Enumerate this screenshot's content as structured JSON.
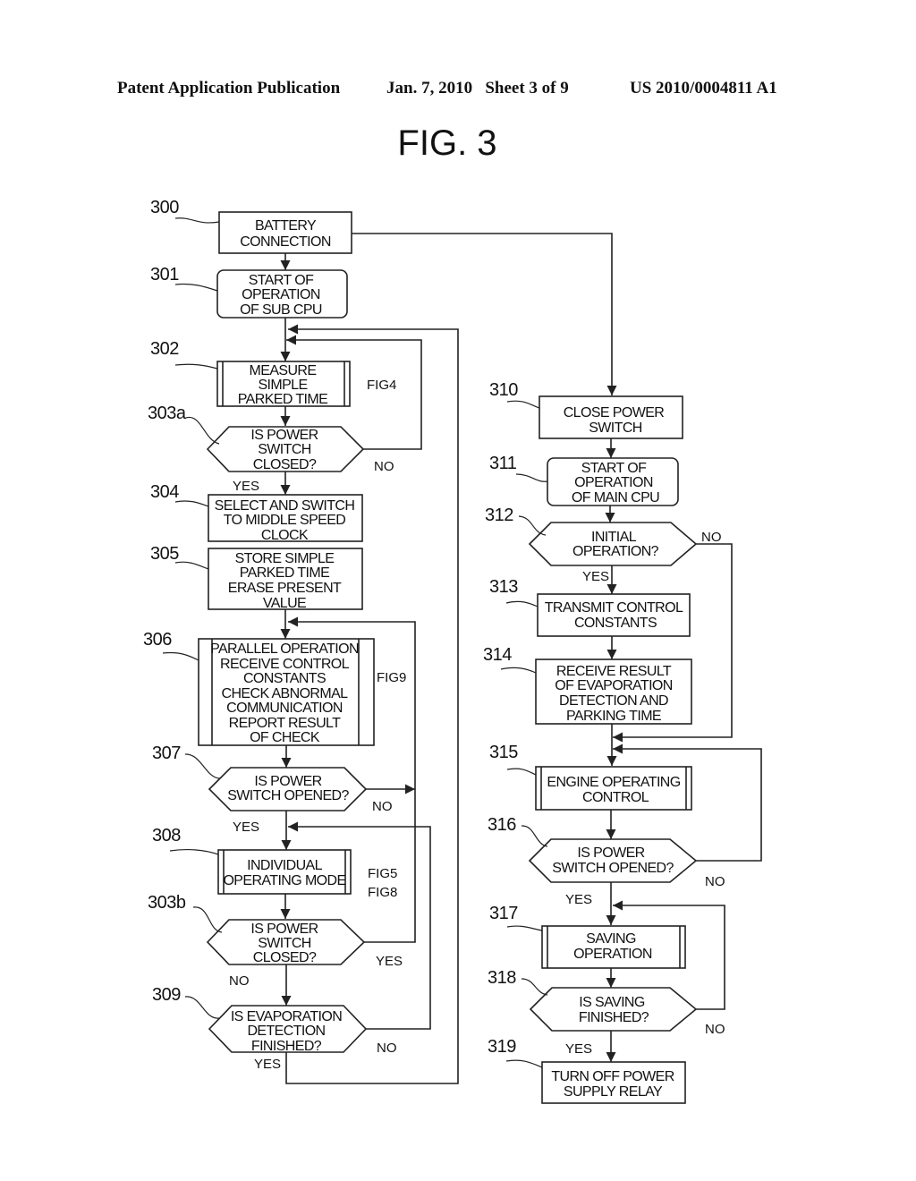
{
  "header": {
    "left": "Patent Application Publication",
    "middle": "Jan. 7, 2010   Sheet 3 of 9",
    "right": "US 2010/0004811 A1"
  },
  "figure_title": "FIG. 3",
  "steps": {
    "s300": {
      "ref": "300",
      "lines": [
        "BATTERY",
        "CONNECTION"
      ]
    },
    "s301": {
      "ref": "301",
      "lines": [
        "START OF",
        "OPERATION",
        "OF SUB CPU"
      ]
    },
    "s302": {
      "ref": "302",
      "lines": [
        "MEASURE",
        "SIMPLE",
        "PARKED TIME"
      ],
      "fig_ref": "FIG4"
    },
    "s303a": {
      "ref": "303a",
      "lines": [
        "IS POWER",
        "SWITCH",
        "CLOSED?"
      ]
    },
    "s304": {
      "ref": "304",
      "lines": [
        "SELECT AND SWITCH",
        "TO MIDDLE SPEED",
        "CLOCK"
      ]
    },
    "s305": {
      "ref": "305",
      "lines": [
        "STORE SIMPLE",
        "PARKED TIME",
        "ERASE PRESENT",
        "VALUE"
      ]
    },
    "s306": {
      "ref": "306",
      "lines": [
        "PARALLEL OPERATION",
        "RECEIVE CONTROL",
        "CONSTANTS",
        "CHECK ABNORMAL",
        "COMMUNICATION",
        "REPORT RESULT",
        "OF CHECK"
      ],
      "fig_ref": "FIG9"
    },
    "s307": {
      "ref": "307",
      "lines": [
        "IS POWER",
        "SWITCH OPENED?"
      ]
    },
    "s308": {
      "ref": "308",
      "lines": [
        "INDIVIDUAL",
        "OPERATING MODE"
      ],
      "fig_ref_1": "FIG5",
      "fig_ref_2": "FIG8"
    },
    "s303b": {
      "ref": "303b",
      "lines": [
        "IS POWER",
        "SWITCH",
        "CLOSED?"
      ]
    },
    "s309": {
      "ref": "309",
      "lines": [
        "IS EVAPORATION",
        "DETECTION",
        "FINISHED?"
      ]
    },
    "s310": {
      "ref": "310",
      "lines": [
        "CLOSE POWER",
        "SWITCH"
      ]
    },
    "s311": {
      "ref": "311",
      "lines": [
        "START OF",
        "OPERATION",
        "OF MAIN CPU"
      ]
    },
    "s312": {
      "ref": "312",
      "lines": [
        "INITIAL",
        "OPERATION?"
      ]
    },
    "s313": {
      "ref": "313",
      "lines": [
        "TRANSMIT CONTROL",
        "CONSTANTS"
      ]
    },
    "s314": {
      "ref": "314",
      "lines": [
        "RECEIVE RESULT",
        "OF EVAPORATION",
        "DETECTION AND",
        "PARKING TIME"
      ]
    },
    "s315": {
      "ref": "315",
      "lines": [
        "ENGINE OPERATING",
        "CONTROL"
      ]
    },
    "s316": {
      "ref": "316",
      "lines": [
        "IS POWER",
        "SWITCH OPENED?"
      ]
    },
    "s317": {
      "ref": "317",
      "lines": [
        "SAVING",
        "OPERATION"
      ]
    },
    "s318": {
      "ref": "318",
      "lines": [
        "IS SAVING",
        "FINISHED?"
      ]
    },
    "s319": {
      "ref": "319",
      "lines": [
        "TURN OFF POWER",
        "SUPPLY RELAY"
      ]
    }
  },
  "branch_labels": {
    "yes": "YES",
    "no": "NO"
  }
}
